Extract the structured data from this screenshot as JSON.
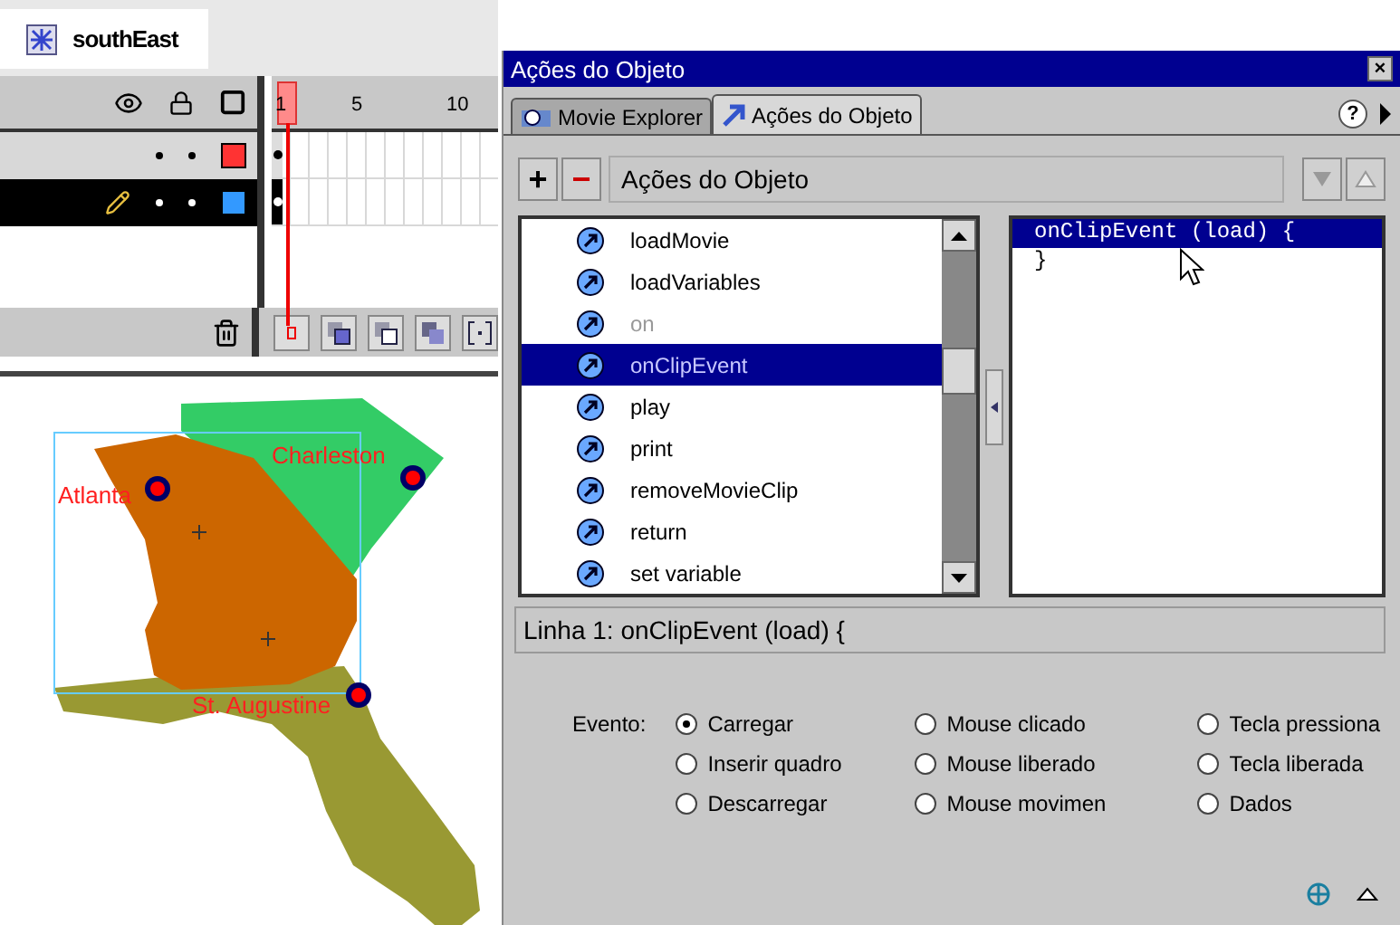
{
  "document_tab": {
    "title": "southEast"
  },
  "timeline": {
    "frame_numbers": [
      "1",
      "5",
      "10"
    ],
    "layers": [
      {
        "selected": false,
        "color": "#ff3333"
      },
      {
        "selected": true,
        "color": "#3399ff"
      }
    ]
  },
  "stage": {
    "cities": [
      {
        "name": "Atlanta"
      },
      {
        "name": "Charleston"
      },
      {
        "name": "St. Augustine"
      }
    ]
  },
  "panel": {
    "title": "Ações do Objeto",
    "close": "×",
    "help": "?",
    "tabs": [
      {
        "label": "Movie Explorer",
        "selected": false
      },
      {
        "label": "Ações do Objeto",
        "selected": true
      }
    ],
    "toolbar": {
      "add": "+",
      "remove": "−",
      "label": "Ações do Objeto"
    },
    "actions": [
      {
        "label": "loadMovie",
        "selected": false,
        "disabled": false
      },
      {
        "label": "loadVariables",
        "selected": false,
        "disabled": false
      },
      {
        "label": "on",
        "selected": false,
        "disabled": true
      },
      {
        "label": "onClipEvent",
        "selected": true,
        "disabled": false
      },
      {
        "label": "play",
        "selected": false,
        "disabled": false
      },
      {
        "label": "print",
        "selected": false,
        "disabled": false
      },
      {
        "label": "removeMovieClip",
        "selected": false,
        "disabled": false
      },
      {
        "label": "return",
        "selected": false,
        "disabled": false
      },
      {
        "label": "set variable",
        "selected": false,
        "disabled": false
      }
    ],
    "code_lines": [
      {
        "text": "onClipEvent (load) {",
        "selected": true
      },
      {
        "text": "}",
        "selected": false
      }
    ],
    "status": "Linha 1: onClipEvent (load) {",
    "event_label": "Evento:",
    "events": [
      {
        "label": "Carregar",
        "checked": true
      },
      {
        "label": "Mouse clicado",
        "checked": false
      },
      {
        "label": "Tecla pressiona",
        "checked": false
      },
      {
        "label": "Inserir quadro",
        "checked": false
      },
      {
        "label": "Mouse liberado",
        "checked": false
      },
      {
        "label": "Tecla liberada",
        "checked": false
      },
      {
        "label": "Descarregar",
        "checked": false
      },
      {
        "label": "Mouse movimen",
        "checked": false
      },
      {
        "label": "Dados",
        "checked": false
      }
    ]
  }
}
